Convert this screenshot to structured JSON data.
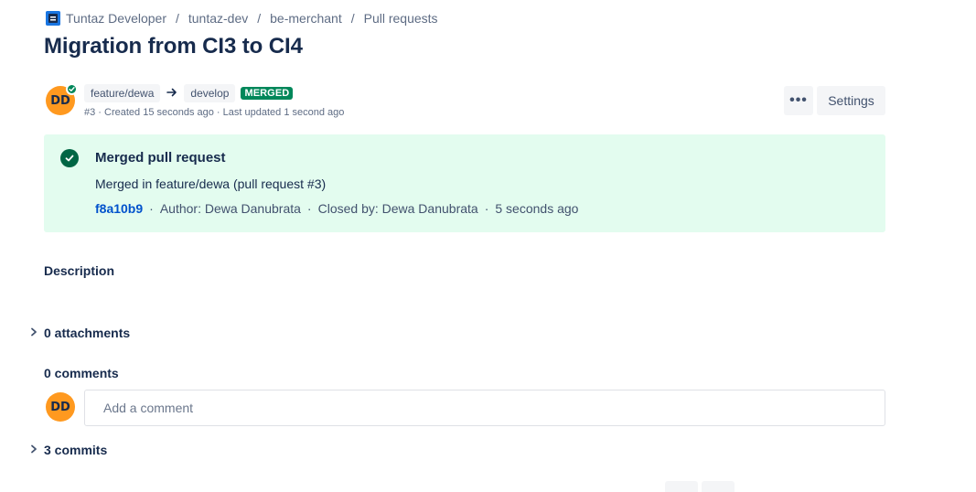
{
  "breadcrumb": {
    "workspace": "Tuntaz Developer",
    "project": "tuntaz-dev",
    "repository": "be-merchant",
    "section": "Pull requests",
    "separator": "/"
  },
  "page_title": "Migration from CI3 to CI4",
  "pull_request": {
    "author_initials": "DD",
    "source_branch": "feature/dewa",
    "destination_branch": "develop",
    "status": "MERGED",
    "meta": "#3 · Created 15 seconds ago · Last updated 1 second ago"
  },
  "actions": {
    "more_label": "•••",
    "settings_label": "Settings"
  },
  "merged_panel": {
    "title": "Merged pull request",
    "message": "Merged in feature/dewa (pull request #3)",
    "commit_hash": "f8a10b9",
    "author": "Author: Dewa Danubrata",
    "closed_by": "Closed by: Dewa Danubrata",
    "time": "5 seconds ago",
    "separator": "·"
  },
  "description": {
    "label": "Description"
  },
  "attachments": {
    "label": "0 attachments"
  },
  "comments": {
    "label": "0 comments",
    "user_initials": "DD",
    "placeholder": "Add a comment"
  },
  "commits": {
    "label": "3 commits"
  },
  "icons": {
    "repo": "repository-icon",
    "arrow": "arrow-right-icon",
    "check": "check-circle-icon",
    "chevron": "chevron-right-icon"
  },
  "colors": {
    "accent": "#0052cc",
    "merged_green": "#00875a",
    "success_bg": "#e3fcef",
    "avatar": "#ff991f"
  }
}
